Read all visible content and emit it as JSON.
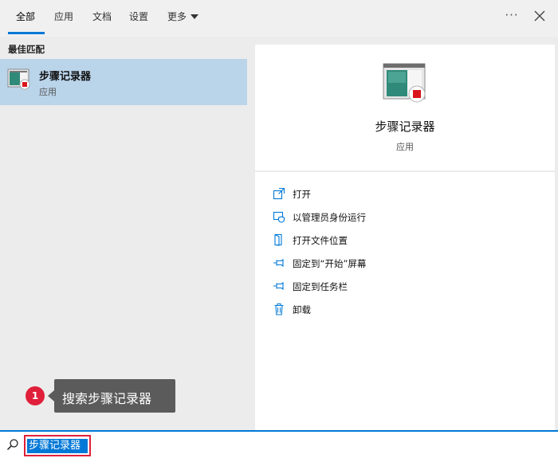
{
  "tabs": [
    {
      "label": "全部"
    },
    {
      "label": "应用"
    },
    {
      "label": "文档"
    },
    {
      "label": "设置"
    },
    {
      "label": "更多"
    }
  ],
  "more_options": "···",
  "best_match": {
    "section_label": "最佳匹配",
    "title": "步骤记录器",
    "subtitle": "应用"
  },
  "detail": {
    "title": "步骤记录器",
    "subtitle": "应用",
    "actions": [
      {
        "label": "打开",
        "icon": "open-icon"
      },
      {
        "label": "以管理员身份运行",
        "icon": "shield-run-admin-icon"
      },
      {
        "label": "打开文件位置",
        "icon": "file-location-icon"
      },
      {
        "label": "固定到“开始”屏幕",
        "icon": "pin-icon"
      },
      {
        "label": "固定到任务栏",
        "icon": "pin-icon"
      },
      {
        "label": "卸载",
        "icon": "trash-icon"
      }
    ]
  },
  "callout": {
    "number": "1",
    "text": "搜索步骤记录器"
  },
  "search": {
    "value": "步骤记录器"
  },
  "colors": {
    "accent": "#0078d7",
    "selection": "#bad4ea",
    "callout_red": "#e0203a",
    "callout_bg": "#5b5b5b"
  }
}
